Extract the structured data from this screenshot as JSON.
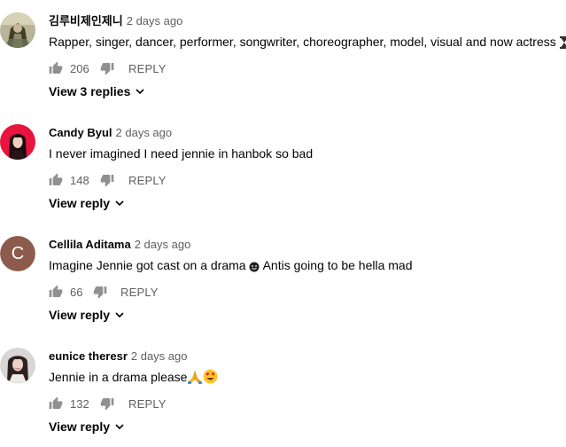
{
  "comments": [
    {
      "author": "김루비제인제니",
      "time": "2 days ago",
      "text": "Rapper, singer, dancer, performer, songwriter, choreographer, model, visual and now actress",
      "likes": "206",
      "reply_label": "REPLY",
      "replies_label": "View 3 replies",
      "avatar": "photo"
    },
    {
      "author": "Candy Byul",
      "time": "2 days ago",
      "text": "I never imagined I need jennie in hanbok so bad",
      "likes": "148",
      "reply_label": "REPLY",
      "replies_label": "View reply",
      "avatar": "photo"
    },
    {
      "author": "Cellila Aditama",
      "time": "2 days ago",
      "text_before": "Imagine Jennie got cast on a drama",
      "text_after": "Antis going to be hella mad",
      "likes": "66",
      "reply_label": "REPLY",
      "replies_label": "View reply",
      "avatar_letter": "C",
      "avatar_color": "#8d5b4c"
    },
    {
      "author": "eunice theresr",
      "time": "2 days ago",
      "text": "Jennie in a drama please",
      "likes": "132",
      "reply_label": "REPLY",
      "replies_label": "View reply",
      "avatar": "photo"
    }
  ],
  "icons": {
    "like": "thumb-up-icon",
    "dislike": "thumb-down-icon",
    "chevron": "chevron-down-icon",
    "trailing_emoji_1": "hourglass-emoji",
    "emoji_3": "smiling-face-emoji",
    "emoji_4a": "folded-hands-emoji",
    "emoji_4b": "heart-eyes-emoji"
  },
  "colors": {
    "primary_text": "#030303",
    "secondary_text": "#606060",
    "letter_avatar": "#8d5b4c"
  }
}
